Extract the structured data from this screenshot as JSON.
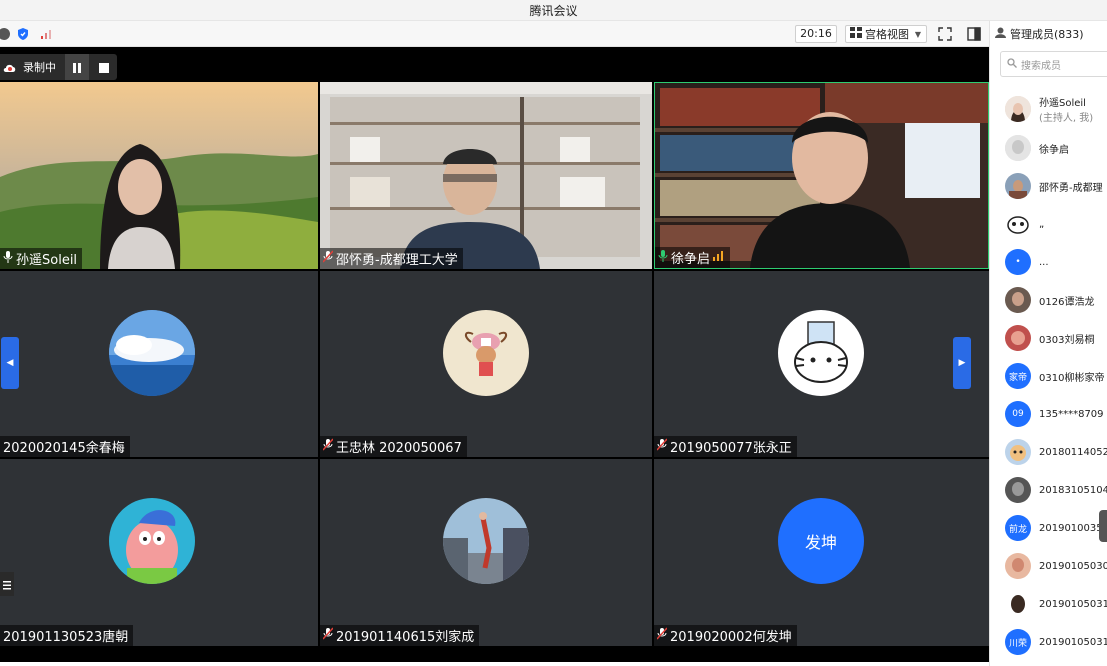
{
  "window": {
    "title": "腾讯会议"
  },
  "toolbar": {
    "time": "20:16",
    "view_label": "宫格视图",
    "icons": [
      "info-icon",
      "shield-icon",
      "signal-icon",
      "fullscreen-icon",
      "sidebar-toggle-icon"
    ]
  },
  "recording": {
    "label": "录制中"
  },
  "tiles": [
    {
      "name": "孙遥Soleil",
      "mic": "on",
      "type": "video"
    },
    {
      "name": "邵怀勇-成都理工大学",
      "mic": "muted",
      "type": "video"
    },
    {
      "name": "徐争启",
      "mic": "on",
      "type": "video"
    },
    {
      "name": "2020020145余春梅",
      "mic": "none",
      "type": "avatar"
    },
    {
      "name": "王忠林 2020050067",
      "mic": "muted",
      "type": "avatar"
    },
    {
      "name": "2019050077张永正",
      "mic": "muted",
      "type": "avatar"
    },
    {
      "name": "201901130523唐朝",
      "mic": "none",
      "type": "avatar"
    },
    {
      "name": "201901140615刘家成",
      "mic": "muted",
      "type": "avatar"
    },
    {
      "name": "2019020002何发坤",
      "mic": "muted",
      "type": "avatar",
      "avatar_text": "发坤"
    }
  ],
  "panel": {
    "title": "管理成员(833)",
    "search_placeholder": "搜索成员",
    "members": [
      {
        "name": "孙遥Soleil",
        "sub": "(主持人, 我)",
        "avatar": "photo",
        "color": "#d9c9c0"
      },
      {
        "name": "徐争启",
        "avatar": "photo",
        "color": "#cfcfcf"
      },
      {
        "name": "邵怀勇-成都理",
        "avatar": "photo",
        "color": "#8a6e5a"
      },
      {
        "name": "„",
        "avatar": "photo",
        "color": "#ffffff"
      },
      {
        "name": "...",
        "avatar": "text",
        "avatar_text": "•",
        "color": "#1f6fff"
      },
      {
        "name": "0126谭浩龙",
        "avatar": "photo",
        "color": "#5a4a42"
      },
      {
        "name": "0303刘易桐",
        "avatar": "photo",
        "color": "#c0504d"
      },
      {
        "name": "0310柳彬家帝",
        "avatar": "text",
        "avatar_text": "家帝",
        "color": "#1f6fff"
      },
      {
        "name": "135****8709",
        "avatar": "text",
        "avatar_text": "09",
        "color": "#1f6fff"
      },
      {
        "name": "20180114052",
        "avatar": "photo",
        "color": "#8fb3d9"
      },
      {
        "name": "20183105104",
        "avatar": "photo",
        "color": "#444444"
      },
      {
        "name": "2019010035",
        "avatar": "text",
        "avatar_text": "前龙",
        "color": "#1f6fff"
      },
      {
        "name": "20190105030",
        "avatar": "photo",
        "color": "#d99a7a"
      },
      {
        "name": "20190105031",
        "avatar": "photo",
        "color": "#3a2a22"
      },
      {
        "name": "20190105031",
        "avatar": "text",
        "avatar_text": "川荣",
        "color": "#1f6fff"
      }
    ]
  }
}
